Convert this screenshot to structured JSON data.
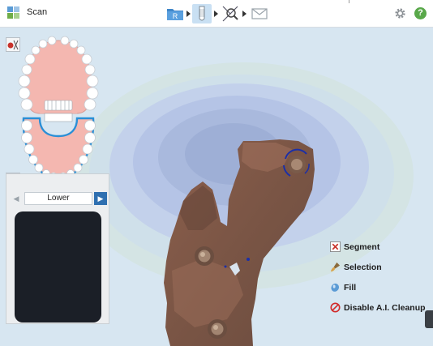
{
  "app": {
    "title": "Scan"
  },
  "workflow": {
    "steps": [
      {
        "icon": "rx-icon",
        "label": "R"
      },
      {
        "icon": "scan-tooth-icon"
      },
      {
        "icon": "view-magnify-icon"
      },
      {
        "icon": "send-mail-icon"
      }
    ]
  },
  "header_actions": {
    "settings_icon": "gear-icon",
    "help_label": "?"
  },
  "jaw_panel": {
    "selected_jaw": "Lower",
    "prev_symbol": "◀",
    "next_symbol": "▶"
  },
  "tools": [
    {
      "icon": "segment-icon",
      "label": "Segment"
    },
    {
      "icon": "selection-brush-icon",
      "label": "Selection"
    },
    {
      "icon": "fill-drop-icon",
      "label": "Fill"
    },
    {
      "icon": "disable-icon",
      "label": "Disable A.I. Cleanup"
    }
  ],
  "colors": {
    "accent": "#2f6fb0",
    "arch_highlight": "#2a8fd6",
    "gum": "#f4b7b0",
    "scan_tissue": "#8a5a48",
    "help_green": "#59a84a"
  }
}
